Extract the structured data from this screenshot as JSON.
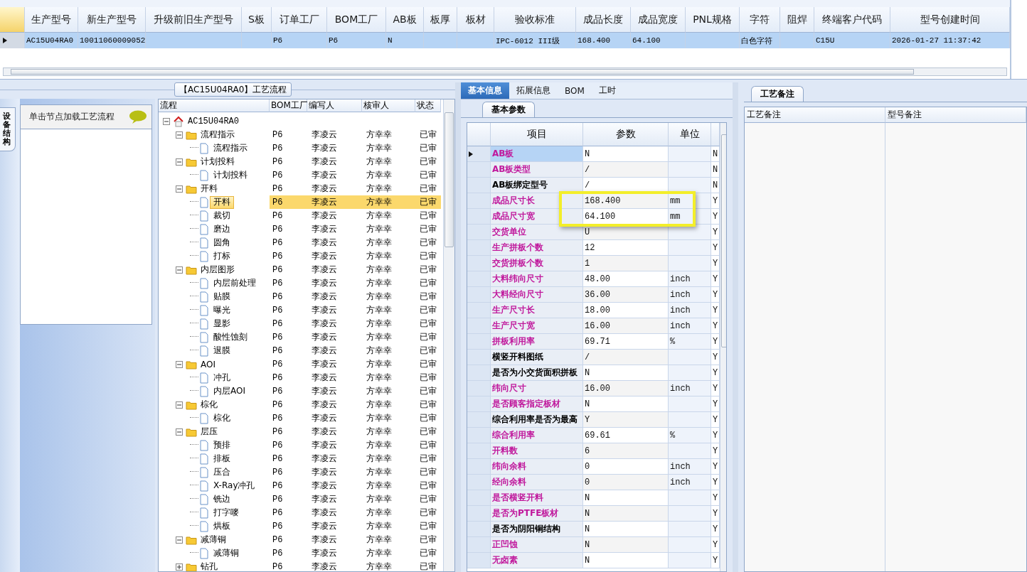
{
  "top_grid": {
    "columns": [
      "生产型号",
      "新生产型号",
      "升级前旧生产型号",
      "S板",
      "订单工厂",
      "BOM工厂",
      "AB板",
      "板厚",
      "板材",
      "验收标准",
      "成品长度",
      "成品宽度",
      "PNL规格",
      "字符",
      "阻焊",
      "终端客户代码",
      "型号创建时间"
    ],
    "rows": [
      {
        "selected": true,
        "cells": [
          "AC15U04RA0",
          "10011060009052",
          null,
          null,
          "P6",
          "P6",
          "N",
          null,
          null,
          "IPC-6012 III级",
          "168.400",
          "64.100",
          null,
          "白色字符",
          null,
          "C15U",
          "2026-01-27 11:37:42"
        ]
      }
    ]
  },
  "left_panel": {
    "vertical_tab": "设备结构",
    "hint": "单击节点加载工艺流程"
  },
  "flow": {
    "title": "【AC15U04RA0】工艺流程",
    "columns": [
      "流程",
      "BOM工厂",
      "编写人",
      "核审人",
      "状态"
    ],
    "tree": {
      "label": "AC15U04RA0",
      "kind": "root",
      "expanded": true,
      "selected": false,
      "children": [
        {
          "label": "流程指示",
          "kind": "folder",
          "expanded": true,
          "selected": false,
          "cells": [
            "P6",
            "李凌云",
            "方幸幸",
            "已审"
          ],
          "children": [
            {
              "label": "流程指示",
              "kind": "file",
              "selected": false,
              "cells": [
                "P6",
                "李凌云",
                "方幸幸",
                "已审"
              ]
            }
          ]
        },
        {
          "label": "计划投料",
          "kind": "folder",
          "expanded": true,
          "selected": false,
          "cells": [
            "P6",
            "李凌云",
            "方幸幸",
            "已审"
          ],
          "children": [
            {
              "label": "计划投料",
              "kind": "file",
              "selected": false,
              "cells": [
                "P6",
                "李凌云",
                "方幸幸",
                "已审"
              ]
            }
          ]
        },
        {
          "label": "开料",
          "kind": "folder",
          "expanded": true,
          "selected": false,
          "cells": [
            "P6",
            "李凌云",
            "方幸幸",
            "已审"
          ],
          "children": [
            {
              "label": "开料",
              "kind": "file",
              "selected": true,
              "cells": [
                "P6",
                "李凌云",
                "方幸幸",
                "已审"
              ]
            },
            {
              "label": "裁切",
              "kind": "file",
              "selected": false,
              "cells": [
                "P6",
                "李凌云",
                "方幸幸",
                "已审"
              ]
            },
            {
              "label": "磨边",
              "kind": "file",
              "selected": false,
              "cells": [
                "P6",
                "李凌云",
                "方幸幸",
                "已审"
              ]
            },
            {
              "label": "圆角",
              "kind": "file",
              "selected": false,
              "cells": [
                "P6",
                "李凌云",
                "方幸幸",
                "已审"
              ]
            },
            {
              "label": "打标",
              "kind": "file",
              "selected": false,
              "cells": [
                "P6",
                "李凌云",
                "方幸幸",
                "已审"
              ]
            }
          ]
        },
        {
          "label": "内层图形",
          "kind": "folder",
          "expanded": true,
          "selected": false,
          "cells": [
            "P6",
            "李凌云",
            "方幸幸",
            "已审"
          ],
          "children": [
            {
              "label": "内层前处理",
              "kind": "file",
              "selected": false,
              "cells": [
                "P6",
                "李凌云",
                "方幸幸",
                "已审"
              ]
            },
            {
              "label": "贴膜",
              "kind": "file",
              "selected": false,
              "cells": [
                "P6",
                "李凌云",
                "方幸幸",
                "已审"
              ]
            },
            {
              "label": "曝光",
              "kind": "file",
              "selected": false,
              "cells": [
                "P6",
                "李凌云",
                "方幸幸",
                "已审"
              ]
            },
            {
              "label": "显影",
              "kind": "file",
              "selected": false,
              "cells": [
                "P6",
                "李凌云",
                "方幸幸",
                "已审"
              ]
            },
            {
              "label": "酸性蚀刻",
              "kind": "file",
              "selected": false,
              "cells": [
                "P6",
                "李凌云",
                "方幸幸",
                "已审"
              ]
            },
            {
              "label": "退膜",
              "kind": "file",
              "selected": false,
              "cells": [
                "P6",
                "李凌云",
                "方幸幸",
                "已审"
              ]
            }
          ]
        },
        {
          "label": "AOI",
          "kind": "folder",
          "expanded": true,
          "selected": false,
          "cells": [
            "P6",
            "李凌云",
            "方幸幸",
            "已审"
          ],
          "children": [
            {
              "label": "冲孔",
              "kind": "file",
              "selected": false,
              "cells": [
                "P6",
                "李凌云",
                "方幸幸",
                "已审"
              ]
            },
            {
              "label": "内层AOI",
              "kind": "file",
              "selected": false,
              "cells": [
                "P6",
                "李凌云",
                "方幸幸",
                "已审"
              ]
            }
          ]
        },
        {
          "label": "棕化",
          "kind": "folder",
          "expanded": true,
          "selected": false,
          "cells": [
            "P6",
            "李凌云",
            "方幸幸",
            "已审"
          ],
          "children": [
            {
              "label": "棕化",
              "kind": "file",
              "selected": false,
              "cells": [
                "P6",
                "李凌云",
                "方幸幸",
                "已审"
              ]
            }
          ]
        },
        {
          "label": "层压",
          "kind": "folder",
          "expanded": true,
          "selected": false,
          "cells": [
            "P6",
            "李凌云",
            "方幸幸",
            "已审"
          ],
          "children": [
            {
              "label": "预排",
              "kind": "file",
              "selected": false,
              "cells": [
                "P6",
                "李凌云",
                "方幸幸",
                "已审"
              ]
            },
            {
              "label": "排板",
              "kind": "file",
              "selected": false,
              "cells": [
                "P6",
                "李凌云",
                "方幸幸",
                "已审"
              ]
            },
            {
              "label": "压合",
              "kind": "file",
              "selected": false,
              "cells": [
                "P6",
                "李凌云",
                "方幸幸",
                "已审"
              ]
            },
            {
              "label": "X-Ray冲孔",
              "kind": "file",
              "selected": false,
              "cells": [
                "P6",
                "李凌云",
                "方幸幸",
                "已审"
              ]
            },
            {
              "label": "铣边",
              "kind": "file",
              "selected": false,
              "cells": [
                "P6",
                "李凌云",
                "方幸幸",
                "已审"
              ]
            },
            {
              "label": "打字嘜",
              "kind": "file",
              "selected": false,
              "cells": [
                "P6",
                "李凌云",
                "方幸幸",
                "已审"
              ]
            },
            {
              "label": "烘板",
              "kind": "file",
              "selected": false,
              "cells": [
                "P6",
                "李凌云",
                "方幸幸",
                "已审"
              ]
            }
          ]
        },
        {
          "label": "减薄铜",
          "kind": "folder",
          "expanded": true,
          "selected": false,
          "cells": [
            "P6",
            "李凌云",
            "方幸幸",
            "已审"
          ],
          "children": [
            {
              "label": "减薄铜",
              "kind": "file",
              "selected": false,
              "cells": [
                "P6",
                "李凌云",
                "方幸幸",
                "已审"
              ]
            }
          ]
        },
        {
          "label": "钻孔",
          "kind": "folder",
          "expanded": false,
          "selected": false,
          "cells": [
            "P6",
            "李凌云",
            "方幸幸",
            "已审"
          ]
        }
      ]
    }
  },
  "detail_tabs": [
    {
      "label": "基本信息",
      "selected": true
    },
    {
      "label": "拓展信息",
      "selected": false
    },
    {
      "label": "BOM",
      "selected": false
    },
    {
      "label": "工时",
      "selected": false
    }
  ],
  "params": {
    "tab": "基本参数",
    "columns": [
      "项目",
      "参数",
      "单位"
    ],
    "rows": [
      {
        "item": "AB板",
        "value": "N",
        "flag": "N",
        "color": "#c0189c",
        "selected": true,
        "annotated": false
      },
      {
        "item": "AB板类型",
        "value": "/",
        "flag": "N",
        "color": "#c0189c",
        "selected": false,
        "annotated": false
      },
      {
        "item": "AB板绑定型号",
        "value": "/",
        "flag": "N",
        "color": "#000000",
        "selected": false,
        "annotated": false
      },
      {
        "item": "成品尺寸长",
        "value": "168.400",
        "unit": "mm",
        "flag": "Y",
        "color": "#c0189c",
        "selected": false,
        "annotated": true
      },
      {
        "item": "成品尺寸宽",
        "value": "64.100",
        "unit": "mm",
        "flag": "Y",
        "color": "#c0189c",
        "selected": false,
        "annotated": true
      },
      {
        "item": "交货单位",
        "value": "U",
        "flag": "Y",
        "color": "#c0189c",
        "selected": false,
        "annotated": false
      },
      {
        "item": "生产拼板个数",
        "value": "12",
        "flag": "Y",
        "color": "#c0189c",
        "selected": false,
        "annotated": false
      },
      {
        "item": "交货拼板个数",
        "value": "1",
        "flag": "Y",
        "color": "#c0189c",
        "selected": false,
        "annotated": false
      },
      {
        "item": "大料纬向尺寸",
        "value": "48.00",
        "unit": "inch",
        "flag": "Y",
        "color": "#c0189c",
        "selected": false,
        "annotated": false
      },
      {
        "item": "大料经向尺寸",
        "value": "36.00",
        "unit": "inch",
        "flag": "Y",
        "color": "#c0189c",
        "selected": false,
        "annotated": false
      },
      {
        "item": "生产尺寸长",
        "value": "18.00",
        "unit": "inch",
        "flag": "Y",
        "color": "#c0189c",
        "selected": false,
        "annotated": false
      },
      {
        "item": "生产尺寸宽",
        "value": "16.00",
        "unit": "inch",
        "flag": "Y",
        "color": "#c0189c",
        "selected": false,
        "annotated": false
      },
      {
        "item": "拼板利用率",
        "value": "69.71",
        "unit": "%",
        "flag": "Y",
        "color": "#c0189c",
        "selected": false,
        "annotated": false
      },
      {
        "item": "横竖开料图纸",
        "value": "/",
        "flag": "Y",
        "color": "#000000",
        "selected": false,
        "annotated": false
      },
      {
        "item": "是否为小交货面积拼板",
        "value": "N",
        "flag": "Y",
        "color": "#000000",
        "selected": false,
        "annotated": false
      },
      {
        "item": "纬向尺寸",
        "value": "16.00",
        "unit": "inch",
        "flag": "Y",
        "color": "#c0189c",
        "selected": false,
        "annotated": false
      },
      {
        "item": "是否顾客指定板材",
        "value": "N",
        "flag": "Y",
        "color": "#c0189c",
        "selected": false,
        "annotated": false
      },
      {
        "item": "综合利用率是否为最高",
        "value": "Y",
        "flag": "Y",
        "color": "#000000",
        "selected": false,
        "annotated": false
      },
      {
        "item": "综合利用率",
        "value": "69.61",
        "unit": "%",
        "flag": "Y",
        "color": "#c0189c",
        "selected": false,
        "annotated": false
      },
      {
        "item": "开料数",
        "value": "6",
        "flag": "Y",
        "color": "#c0189c",
        "selected": false,
        "annotated": false
      },
      {
        "item": "纬向余料",
        "value": "0",
        "unit": "inch",
        "flag": "Y",
        "color": "#c0189c",
        "selected": false,
        "annotated": false
      },
      {
        "item": "经向余料",
        "value": "0",
        "unit": "inch",
        "flag": "Y",
        "color": "#c0189c",
        "selected": false,
        "annotated": false
      },
      {
        "item": "是否横竖开料",
        "value": "N",
        "flag": "Y",
        "color": "#c0189c",
        "selected": false,
        "annotated": false
      },
      {
        "item": "是否为PTFE板材",
        "value": "N",
        "flag": "Y",
        "color": "#c0189c",
        "selected": false,
        "annotated": false
      },
      {
        "item": "是否为阴阳铜结构",
        "value": "N",
        "flag": "Y",
        "color": "#000000",
        "selected": false,
        "annotated": false
      },
      {
        "item": "正凹蚀",
        "value": "N",
        "flag": "Y",
        "color": "#c0189c",
        "selected": false,
        "annotated": false
      },
      {
        "item": "无卤素",
        "value": "N",
        "flag": "Y",
        "color": "#c0189c",
        "selected": false,
        "annotated": false
      }
    ]
  },
  "remarks": {
    "tab": "工艺备注",
    "columns": [
      "工艺备注",
      "型号备注"
    ]
  }
}
